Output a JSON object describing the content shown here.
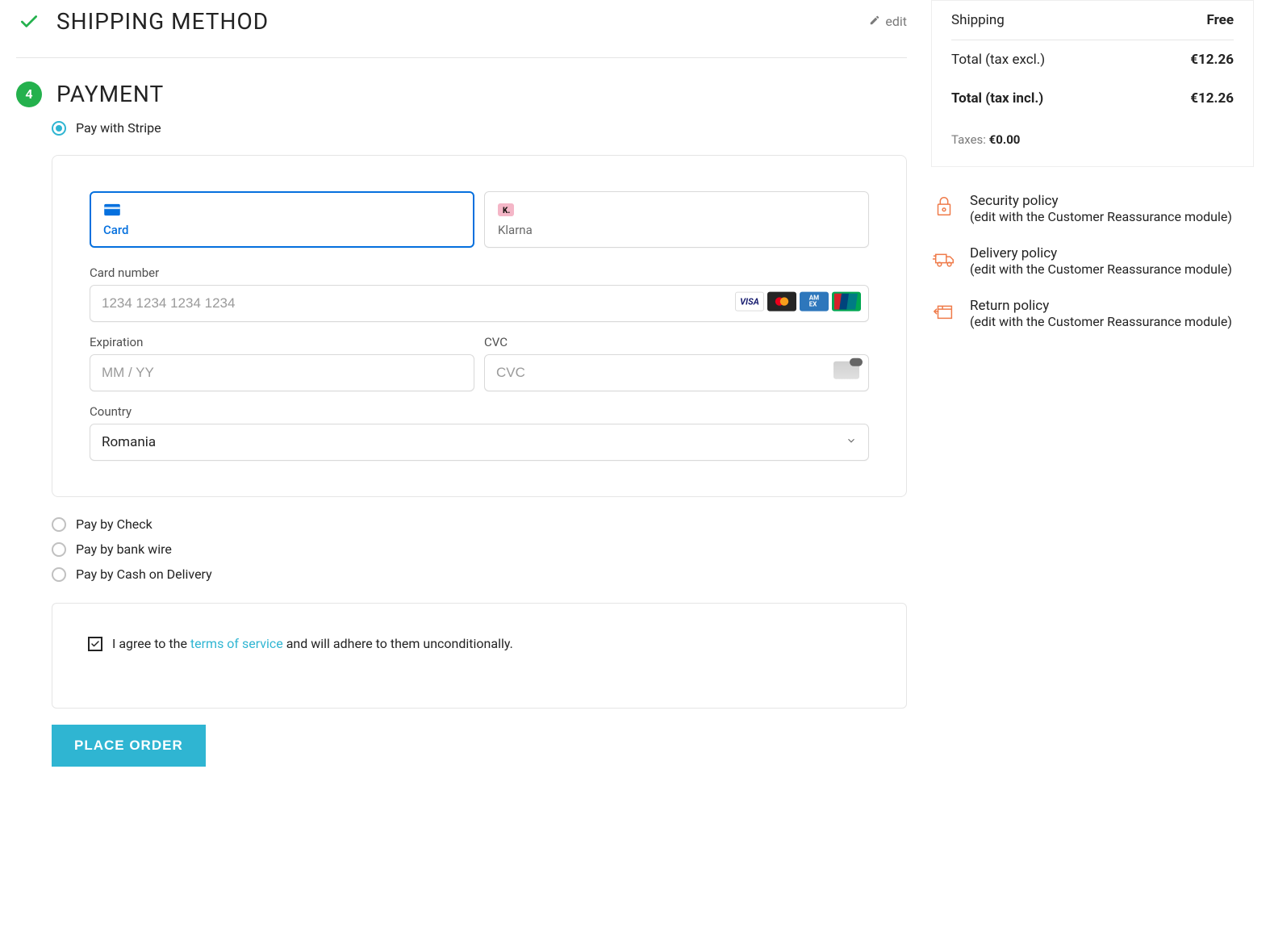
{
  "shipping_section": {
    "title": "SHIPPING METHOD",
    "edit_label": "edit"
  },
  "payment_section": {
    "step_number": "4",
    "title": "PAYMENT",
    "options": {
      "stripe": "Pay with Stripe",
      "check": "Pay by Check",
      "bankwire": "Pay by bank wire",
      "cod": "Pay by Cash on Delivery"
    },
    "stripe_form": {
      "tab_card": "Card",
      "tab_klarna": "Klarna",
      "card_number_label": "Card number",
      "card_number_placeholder": "1234 1234 1234 1234",
      "expiration_label": "Expiration",
      "expiration_placeholder": "MM / YY",
      "cvc_label": "CVC",
      "cvc_placeholder": "CVC",
      "country_label": "Country",
      "country_value": "Romania"
    },
    "terms": {
      "prefix": "I agree to the ",
      "link_text": "terms of service",
      "suffix": " and will adhere to them unconditionally."
    },
    "submit_label": "PLACE ORDER"
  },
  "summary": {
    "shipping_label": "Shipping",
    "shipping_value": "Free",
    "total_excl_label": "Total (tax excl.)",
    "total_excl_value": "€12.26",
    "total_incl_label": "Total (tax incl.)",
    "total_incl_value": "€12.26",
    "taxes_label": "Taxes: ",
    "taxes_value": "€0.00"
  },
  "reassurance": [
    {
      "title": "Security policy",
      "sub": "(edit with the Customer Reassurance module)"
    },
    {
      "title": "Delivery policy",
      "sub": "(edit with the Customer Reassurance module)"
    },
    {
      "title": "Return policy",
      "sub": "(edit with the Customer Reassurance module)"
    }
  ]
}
